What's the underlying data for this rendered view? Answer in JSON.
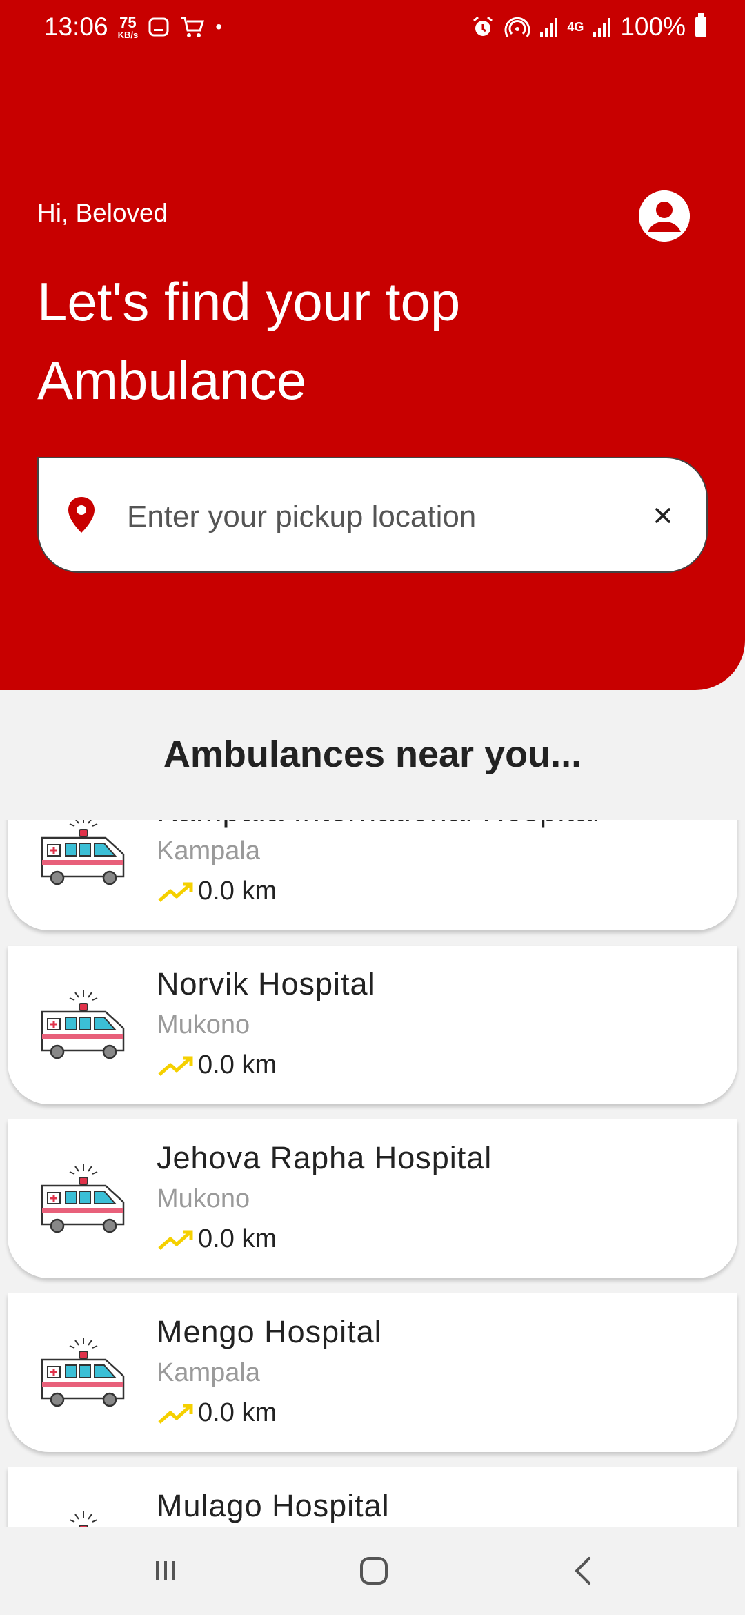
{
  "status_bar": {
    "time": "13:06",
    "net_speed_value": "75",
    "net_speed_unit": "KB/s",
    "dot": "•",
    "network_type": "4G",
    "battery": "100%"
  },
  "header": {
    "greeting": "Hi, Beloved",
    "headline": "Let's find your top Ambulance"
  },
  "search": {
    "placeholder": "Enter your pickup location",
    "value": ""
  },
  "section_title": "Ambulances near you...",
  "ambulances": [
    {
      "name": "Kampala International Hospital",
      "city": "Kampala",
      "distance": "0.0 km"
    },
    {
      "name": "Norvik Hospital",
      "city": "Mukono",
      "distance": "0.0 km"
    },
    {
      "name": "Jehova Rapha Hospital",
      "city": "Mukono",
      "distance": "0.0 km"
    },
    {
      "name": "Mengo Hospital",
      "city": "Kampala",
      "distance": "0.0 km"
    },
    {
      "name": "Mulago Hospital",
      "city": "",
      "distance": ""
    }
  ],
  "colors": {
    "brand_red": "#c80000",
    "trend_yellow": "#f5d000",
    "background": "#f2f2f2"
  },
  "icons": [
    "profile-icon",
    "location-pin-icon",
    "close-icon",
    "ambulance-icon",
    "trending-up-icon",
    "recents-icon",
    "home-icon",
    "back-icon"
  ]
}
